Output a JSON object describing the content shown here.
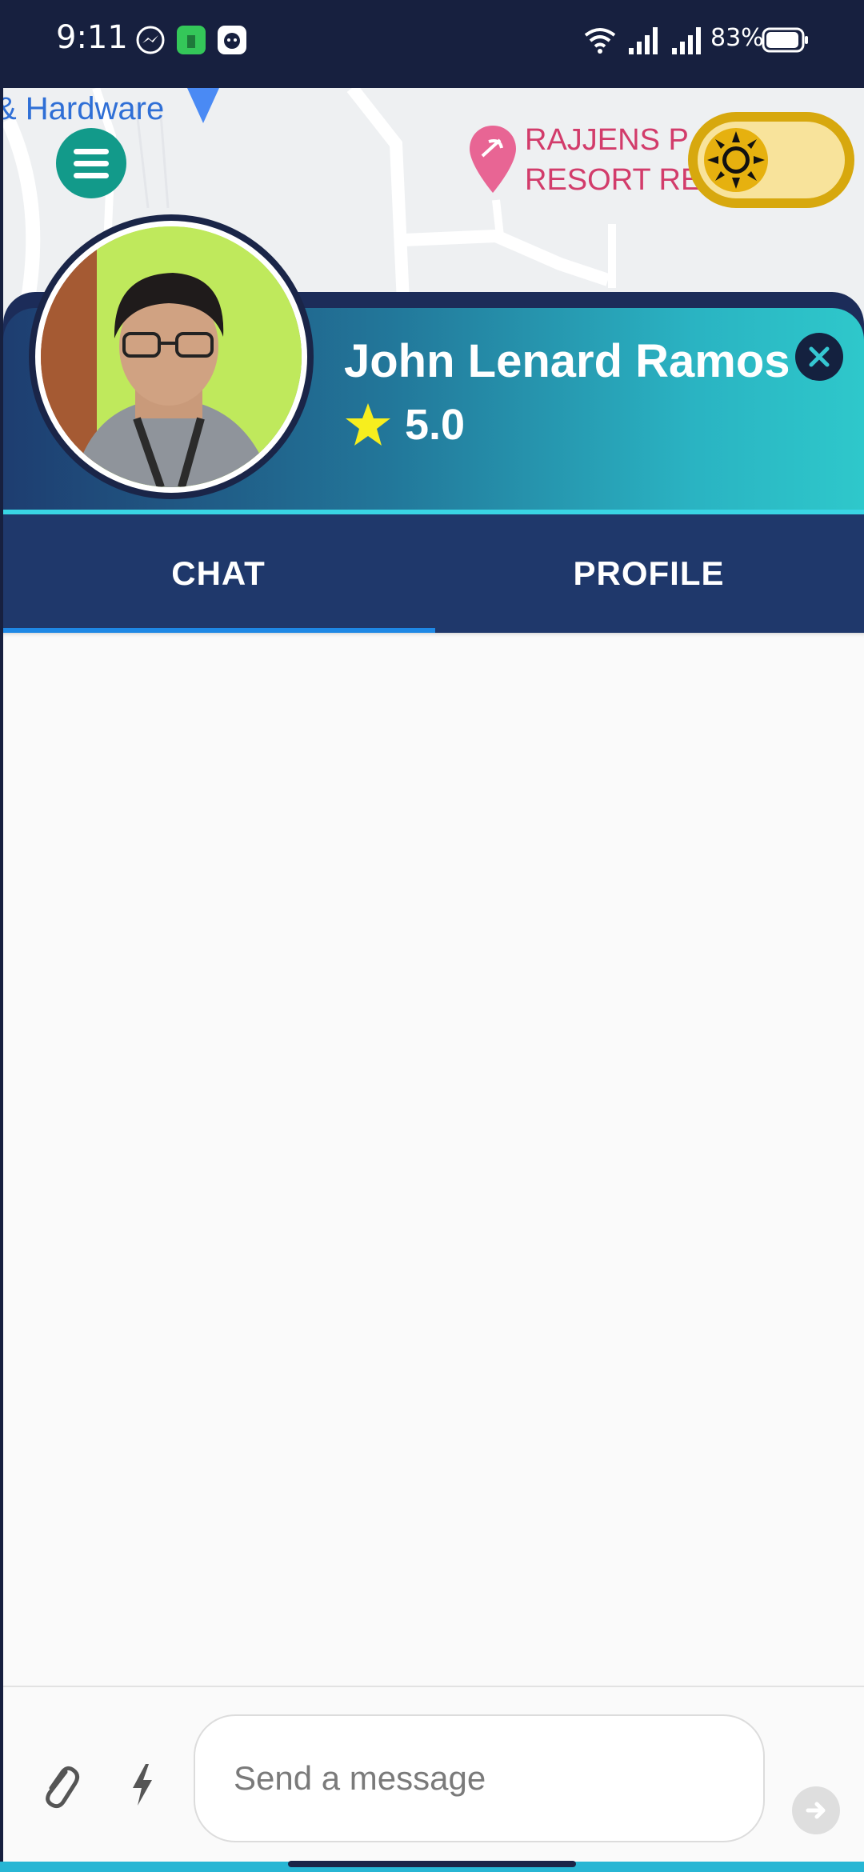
{
  "status_bar": {
    "time": "9:11",
    "battery_percent": "83%",
    "icons": [
      "messenger-icon",
      "store-icon",
      "chat-app-icon",
      "wifi-icon",
      "signal-icon",
      "signal-icon",
      "battery-icon"
    ]
  },
  "map": {
    "label_hardware": "& Hardware",
    "poi_label_line1": "RAJJENS P",
    "poi_label_line2": "RESORT RE"
  },
  "header": {
    "driver_name": "John Lenard Ramos",
    "rating": "5.0",
    "colors": {
      "panel": "#1c2c59",
      "gradient_start": "#1e3d70",
      "gradient_end": "#2ec8cb",
      "star": "#f7ee1e"
    }
  },
  "tabs": [
    {
      "label": "CHAT",
      "active": true
    },
    {
      "label": "PROFILE",
      "active": false
    }
  ],
  "composer": {
    "placeholder": "Send a message",
    "value": ""
  },
  "theme_toggle": {
    "mode_icon": "sun-icon",
    "state": "light"
  }
}
